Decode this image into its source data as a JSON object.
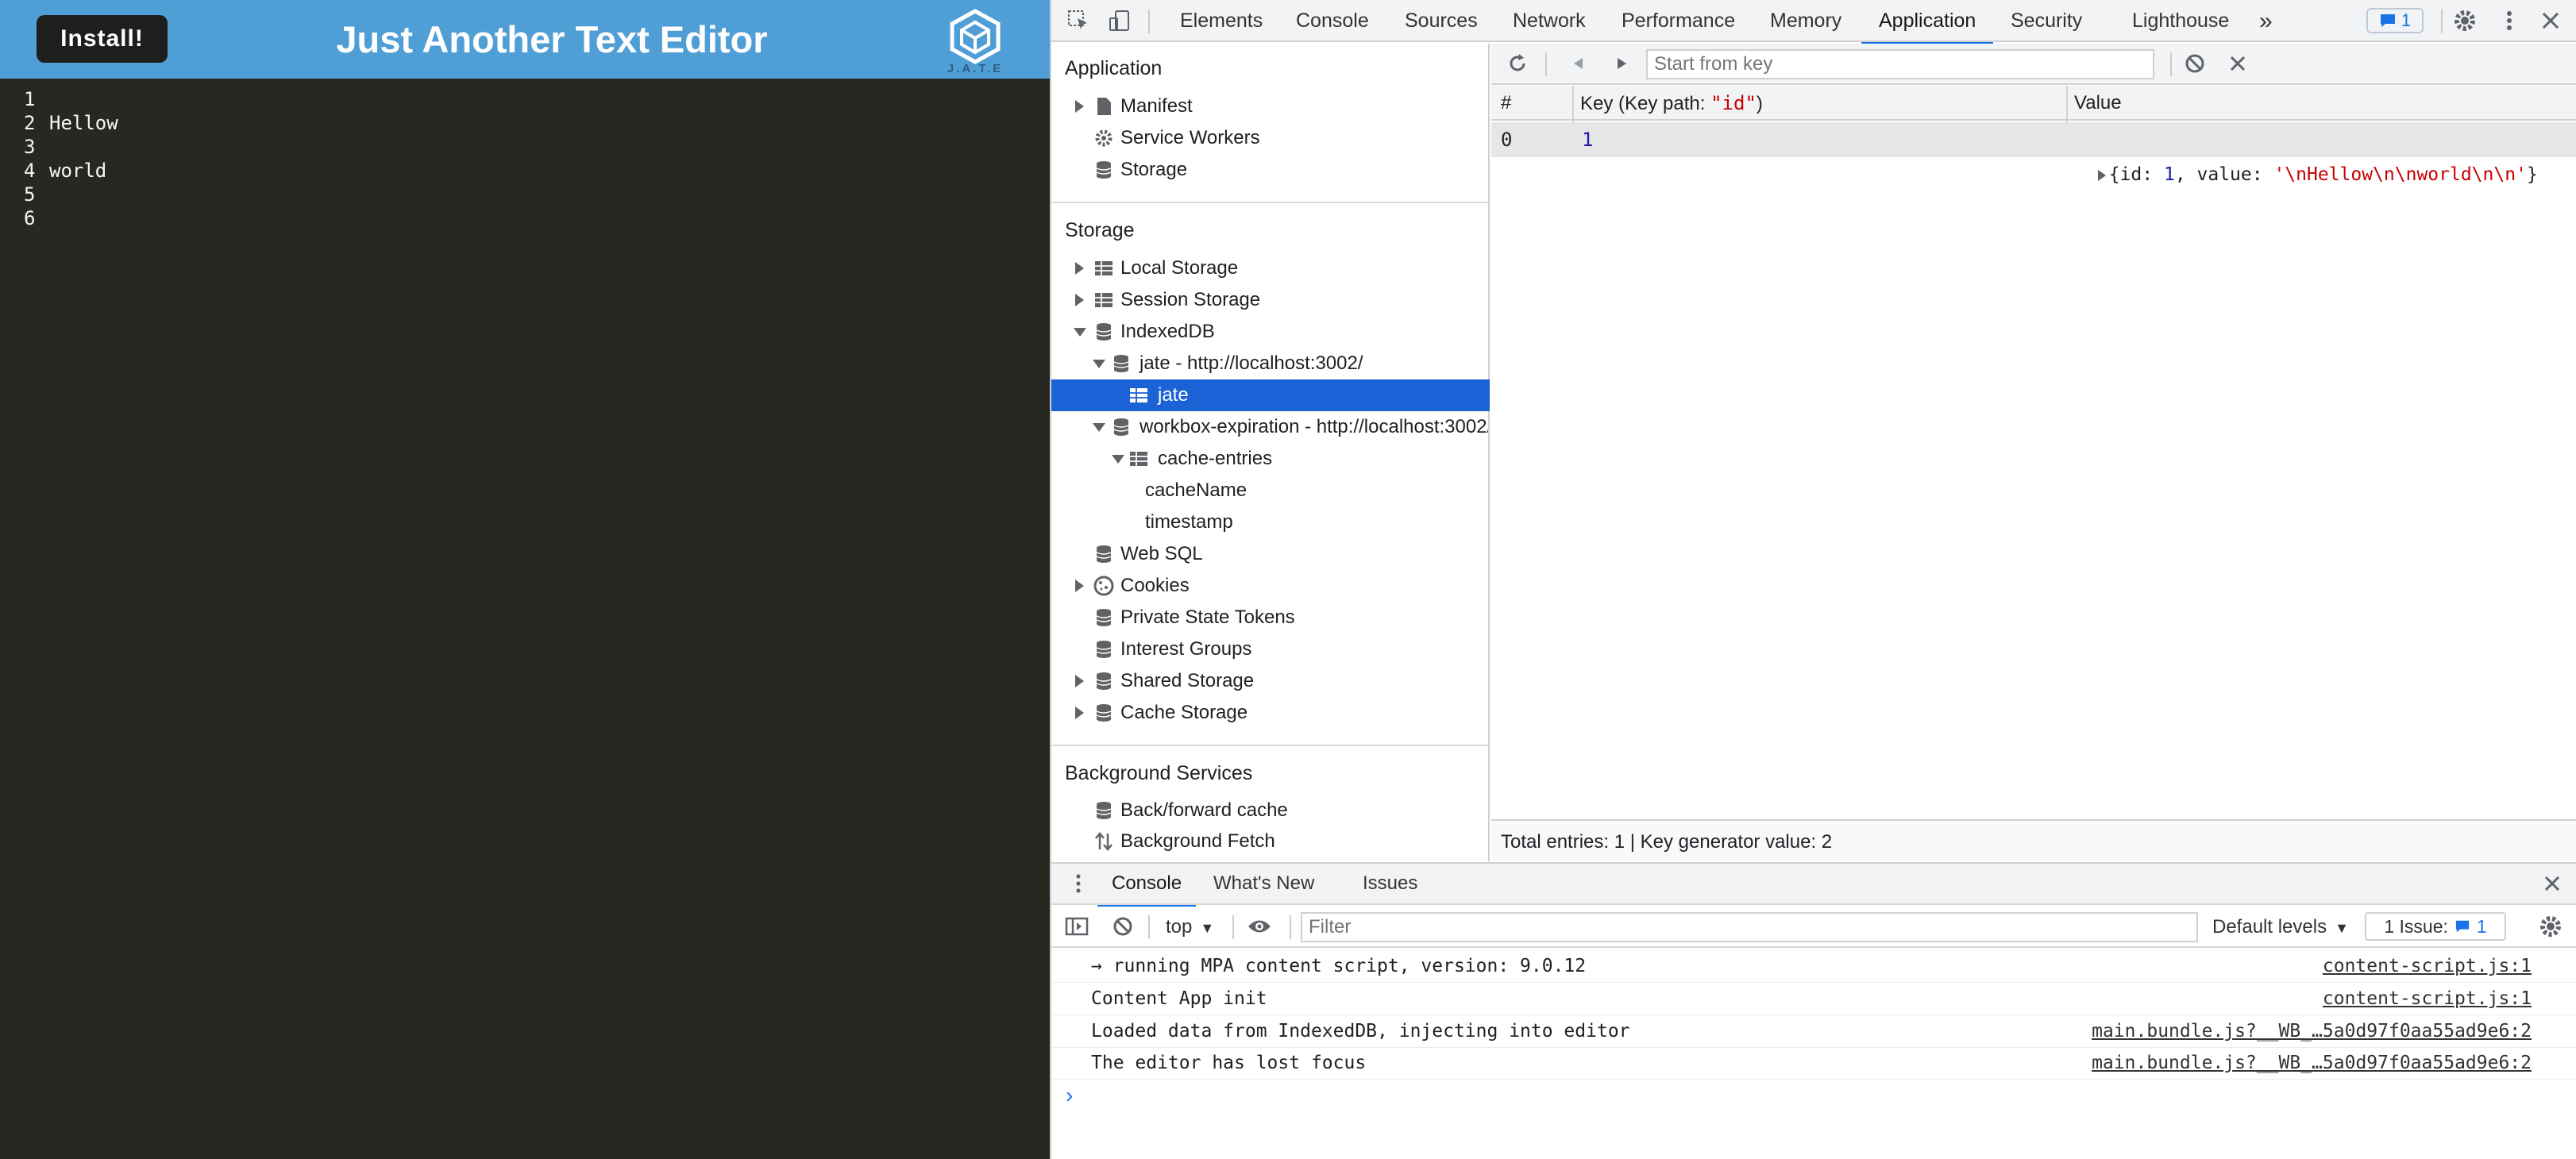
{
  "app": {
    "install_label": "Install!",
    "title": "Just Another Text Editor",
    "logo_text": "J.A.T.E",
    "lines": [
      {
        "num": "1",
        "text": ""
      },
      {
        "num": "2",
        "text": "Hellow"
      },
      {
        "num": "3",
        "text": ""
      },
      {
        "num": "4",
        "text": "world"
      },
      {
        "num": "5",
        "text": ""
      },
      {
        "num": "6",
        "text": ""
      }
    ]
  },
  "devtools": {
    "tabs": [
      "Elements",
      "Console",
      "Sources",
      "Network",
      "Performance",
      "Memory",
      "Application",
      "Security",
      "Lighthouse"
    ],
    "more_tabs": "»",
    "issues_count": "1",
    "sidebar": {
      "application_title": "Application",
      "application_items": [
        "Manifest",
        "Service Workers",
        "Storage"
      ],
      "storage_title": "Storage",
      "storage_items": {
        "local": "Local Storage",
        "session": "Session Storage",
        "indexeddb": "IndexedDB",
        "db_jate": "jate - http://localhost:3002/",
        "store_jate": "jate",
        "db_workbox": "workbox-expiration - http://localhost:3002/",
        "store_cache": "cache-entries",
        "idx_cache_name": "cacheName",
        "idx_timestamp": "timestamp",
        "websql": "Web SQL",
        "cookies": "Cookies",
        "private_tokens": "Private State Tokens",
        "interest_groups": "Interest Groups",
        "shared_storage": "Shared Storage",
        "cache_storage": "Cache Storage"
      },
      "background_title": "Background Services",
      "background_items": [
        "Back/forward cache",
        "Background Fetch"
      ]
    },
    "idb_view": {
      "start_key_placeholder": "Start from key",
      "col_num": "#",
      "col_key_prefix": "Key (Key path: ",
      "col_key_path": "\"id\"",
      "col_key_suffix": ")",
      "col_value": "Value",
      "row": {
        "index": "0",
        "key": "1",
        "value_open": "{id: ",
        "value_id": "1",
        "value_mid": ", value: ",
        "value_str": "'\\nHellow\\n\\nworld\\n\\n'",
        "value_close": "}"
      },
      "footer": "Total entries: 1 | Key generator value: 2"
    },
    "drawer": {
      "tabs": [
        "Console",
        "What's New",
        "Issues"
      ],
      "context": "top",
      "filter_placeholder": "Filter",
      "levels": "Default levels",
      "issues_label": "1 Issue:",
      "issues_count": "1",
      "messages": [
        {
          "text": "→ running MPA content script, version: 9.0.12",
          "source": "content-script.js:1"
        },
        {
          "text": "Content App init",
          "source": "content-script.js:1"
        },
        {
          "text": "Loaded data from IndexedDB, injecting into editor",
          "source": "main.bundle.js?__WB_…5a0d97f0aa55ad9e6:2"
        },
        {
          "text": "The editor has lost focus",
          "source": "main.bundle.js?__WB_…5a0d97f0aa55ad9e6:2"
        }
      ],
      "prompt": "›"
    }
  },
  "colors": {
    "app_header": "#4f9fd6",
    "editor_bg": "#272822",
    "selection": "#1a62d6",
    "accent": "#1a73e8"
  }
}
